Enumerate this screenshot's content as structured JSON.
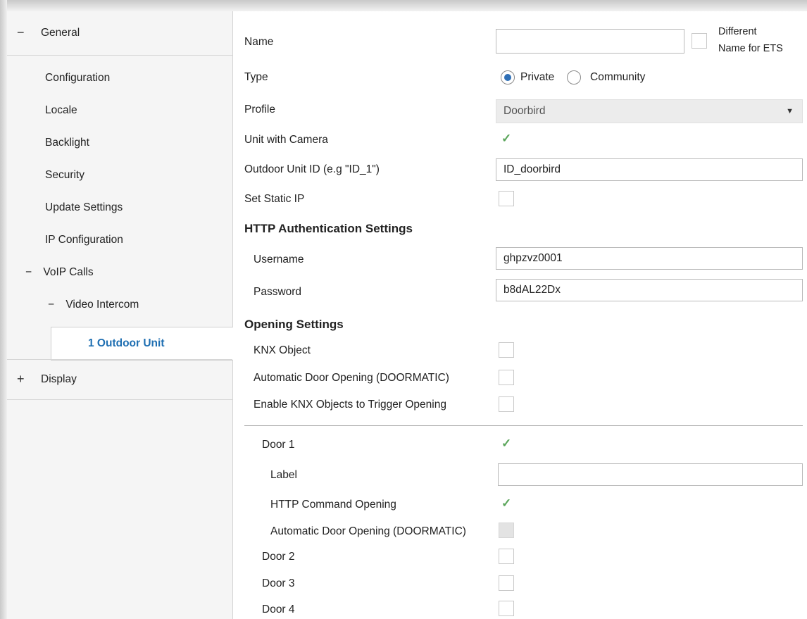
{
  "sidebar": {
    "general": {
      "sign": "−",
      "label": "General"
    },
    "items": [
      "Configuration",
      "Locale",
      "Backlight",
      "Security",
      "Update Settings",
      "IP Configuration"
    ],
    "voip": {
      "sign": "−",
      "label": "VoIP Calls"
    },
    "video": {
      "sign": "−",
      "label": "Video Intercom"
    },
    "selected": "1 Outdoor Unit",
    "display": {
      "sign": "+",
      "label": "Display"
    }
  },
  "form": {
    "name": {
      "label": "Name",
      "value": "",
      "diff_label_1": "Different",
      "diff_label_2": "Name for ETS"
    },
    "type": {
      "label": "Type",
      "options": [
        "Private",
        "Community"
      ],
      "selected": "Private"
    },
    "profile": {
      "label": "Profile",
      "value": "Doorbird"
    },
    "camera": {
      "label": "Unit with Camera",
      "checked": true
    },
    "outdoor_id": {
      "label": "Outdoor Unit ID (e.g \"ID_1\")",
      "value": "ID_doorbird"
    },
    "static_ip": {
      "label": "Set Static IP",
      "checked": false
    },
    "http_header": "HTTP Authentication Settings",
    "username": {
      "label": "Username",
      "value": "ghpzvz0001"
    },
    "password": {
      "label": "Password",
      "value": "b8dAL22Dx"
    },
    "opening_header": "Opening Settings",
    "knx_object": {
      "label": "KNX Object",
      "checked": false
    },
    "auto_door": {
      "label": "Automatic Door Opening (DOORMATIC)",
      "checked": false
    },
    "enable_knx": {
      "label": "Enable KNX Objects to Trigger Opening",
      "checked": false
    },
    "door1": {
      "label": "Door 1",
      "checked": true
    },
    "door1_label": {
      "label": "Label",
      "value": ""
    },
    "http_cmd": {
      "label": "HTTP Command Opening",
      "checked": true
    },
    "door1_auto": {
      "label": "Automatic Door Opening (DOORMATIC)",
      "checked": false,
      "disabled": true
    },
    "door2": {
      "label": "Door 2",
      "checked": false
    },
    "door3": {
      "label": "Door 3",
      "checked": false
    },
    "door4": {
      "label": "Door 4",
      "checked": false
    }
  },
  "icons": {
    "check": "✓",
    "caret": "▼"
  },
  "colors": {
    "selected_text": "#1f6fb2",
    "check": "#5aa55a",
    "radio": "#2f6fb5"
  }
}
